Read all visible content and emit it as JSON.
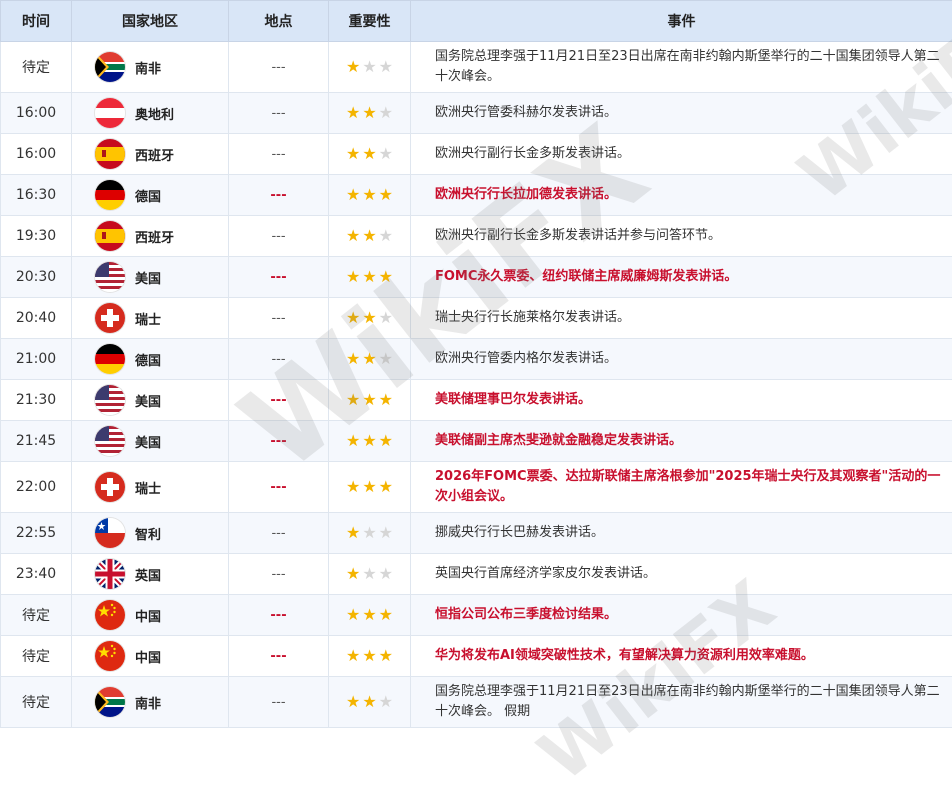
{
  "headers": {
    "time": "时间",
    "country": "国家地区",
    "location": "地点",
    "importance": "重要性",
    "event": "事件"
  },
  "colors": {
    "header_bg": "#d9e6f7",
    "important_text": "#c8102e",
    "star_on": "#f4b400",
    "star_off": "#d6d6d6"
  },
  "watermark": "WikiFX",
  "rows": [
    {
      "time": "待定",
      "country": "南非",
      "flag": "south-africa",
      "location": "---",
      "stars": 1,
      "important": false,
      "event": "国务院总理李强于11月21日至23日出席在南非约翰内斯堡举行的二十国集团领导人第二十次峰会。"
    },
    {
      "time": "16:00",
      "country": "奥地利",
      "flag": "austria",
      "location": "---",
      "stars": 2,
      "important": false,
      "event": "欧洲央行管委科赫尔发表讲话。"
    },
    {
      "time": "16:00",
      "country": "西班牙",
      "flag": "spain",
      "location": "---",
      "stars": 2,
      "important": false,
      "event": "欧洲央行副行长金多斯发表讲话。"
    },
    {
      "time": "16:30",
      "country": "德国",
      "flag": "germany",
      "location": "---",
      "stars": 3,
      "important": true,
      "event": "欧洲央行行长拉加德发表讲话。"
    },
    {
      "time": "19:30",
      "country": "西班牙",
      "flag": "spain",
      "location": "---",
      "stars": 2,
      "important": false,
      "event": "欧洲央行副行长金多斯发表讲话并参与问答环节。"
    },
    {
      "time": "20:30",
      "country": "美国",
      "flag": "usa",
      "location": "---",
      "stars": 3,
      "important": true,
      "event": "FOMC永久票委、纽约联储主席威廉姆斯发表讲话。"
    },
    {
      "time": "20:40",
      "country": "瑞士",
      "flag": "switzerland",
      "location": "---",
      "stars": 2,
      "important": false,
      "event": "瑞士央行行长施莱格尔发表讲话。"
    },
    {
      "time": "21:00",
      "country": "德国",
      "flag": "germany",
      "location": "---",
      "stars": 2,
      "important": false,
      "event": "欧洲央行管委内格尔发表讲话。"
    },
    {
      "time": "21:30",
      "country": "美国",
      "flag": "usa",
      "location": "---",
      "stars": 3,
      "important": true,
      "event": "美联储理事巴尔发表讲话。"
    },
    {
      "time": "21:45",
      "country": "美国",
      "flag": "usa",
      "location": "---",
      "stars": 3,
      "important": true,
      "event": "美联储副主席杰斐逊就金融稳定发表讲话。"
    },
    {
      "time": "22:00",
      "country": "瑞士",
      "flag": "switzerland",
      "location": "---",
      "stars": 3,
      "important": true,
      "event": "2026年FOMC票委、达拉斯联储主席洛根参加\"2025年瑞士央行及其观察者\"活动的一次小组会议。"
    },
    {
      "time": "22:55",
      "country": "智利",
      "flag": "chile",
      "location": "---",
      "stars": 1,
      "important": false,
      "event": "挪威央行行长巴赫发表讲话。"
    },
    {
      "time": "23:40",
      "country": "英国",
      "flag": "uk",
      "location": "---",
      "stars": 1,
      "important": false,
      "event": "英国央行首席经济学家皮尔发表讲话。"
    },
    {
      "time": "待定",
      "country": "中国",
      "flag": "china",
      "location": "---",
      "stars": 3,
      "important": true,
      "event": "恒指公司公布三季度检讨结果。"
    },
    {
      "time": "待定",
      "country": "中国",
      "flag": "china",
      "location": "---",
      "stars": 3,
      "important": true,
      "event": "华为将发布AI领域突破性技术，有望解决算力资源利用效率难题。"
    },
    {
      "time": "待定",
      "country": "南非",
      "flag": "south-africa",
      "location": "---",
      "stars": 2,
      "important": false,
      "event": "国务院总理李强于11月21日至23日出席在南非约翰内斯堡举行的二十国集团领导人第二十次峰会。 假期"
    }
  ]
}
